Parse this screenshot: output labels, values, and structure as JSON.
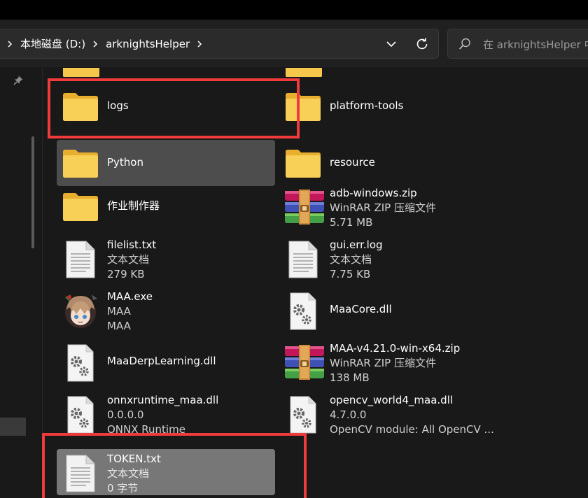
{
  "breadcrumb": {
    "segments": [
      "本地磁盘 (D:)",
      "arknightsHelper"
    ]
  },
  "search": {
    "placeholder": "在 arknightsHelper 中搜索"
  },
  "colors": {
    "highlight": "#ef3b3b",
    "folder": "#f5c84c",
    "selection": "#4d4d4d"
  },
  "files": [
    {
      "name": "logs",
      "type": "",
      "info": "",
      "icon": "folder-icon"
    },
    {
      "name": "platform-tools",
      "type": "",
      "info": "",
      "icon": "folder-icon"
    },
    {
      "name": "Python",
      "type": "",
      "info": "",
      "icon": "folder-icon"
    },
    {
      "name": "resource",
      "type": "",
      "info": "",
      "icon": "folder-icon"
    },
    {
      "name": "作业制作器",
      "type": "",
      "info": "",
      "icon": "folder-icon"
    },
    {
      "name": "adb-windows.zip",
      "type": "WinRAR ZIP 压缩文件",
      "info": "5.71 MB",
      "icon": "winrar-archive-icon"
    },
    {
      "name": "filelist.txt",
      "type": "文本文档",
      "info": "279 KB",
      "icon": "text-document-icon"
    },
    {
      "name": "gui.err.log",
      "type": "文本文档",
      "info": "7.75 KB",
      "icon": "text-document-icon"
    },
    {
      "name": "MAA.exe",
      "type": "MAA",
      "info": "MAA",
      "icon": "maa-app-icon"
    },
    {
      "name": "MaaCore.dll",
      "type": "",
      "info": "",
      "icon": "dll-settings-icon"
    },
    {
      "name": "MaaDerpLearning.dll",
      "type": "",
      "info": "",
      "icon": "dll-settings-icon"
    },
    {
      "name": "MAA-v4.21.0-win-x64.zip",
      "type": "WinRAR ZIP 压缩文件",
      "info": "138 MB",
      "icon": "winrar-archive-icon"
    },
    {
      "name": "onnxruntime_maa.dll",
      "type": "0.0.0.0",
      "info": "ONNX Runtime",
      "icon": "dll-settings-icon"
    },
    {
      "name": "opencv_world4_maa.dll",
      "type": "4.7.0.0",
      "info": "OpenCV module: All OpenCV ...",
      "icon": "dll-settings-icon"
    },
    {
      "name": "TOKEN.txt",
      "type": "文本文档",
      "info": "0 字节",
      "icon": "text-document-icon"
    }
  ]
}
